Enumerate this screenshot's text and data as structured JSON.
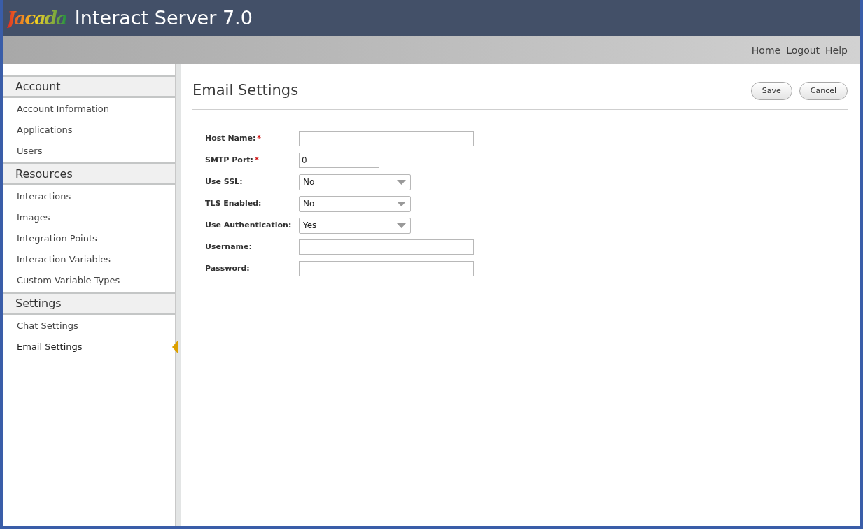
{
  "header": {
    "logo": "Jacada",
    "title": "Interact Server 7.0"
  },
  "top_links": [
    "Home",
    "Logout",
    "Help"
  ],
  "sidebar": [
    {
      "heading": "Account",
      "items": [
        {
          "label": "Account Information",
          "selected": false
        },
        {
          "label": "Applications",
          "selected": false
        },
        {
          "label": "Users",
          "selected": false
        }
      ]
    },
    {
      "heading": "Resources",
      "items": [
        {
          "label": "Interactions",
          "selected": false
        },
        {
          "label": "Images",
          "selected": false
        },
        {
          "label": "Integration Points",
          "selected": false
        },
        {
          "label": "Interaction Variables",
          "selected": false
        },
        {
          "label": "Custom Variable Types",
          "selected": false
        }
      ]
    },
    {
      "heading": "Settings",
      "items": [
        {
          "label": "Chat Settings",
          "selected": false
        },
        {
          "label": "Email Settings",
          "selected": true
        }
      ]
    }
  ],
  "page": {
    "title": "Email Settings",
    "buttons": [
      "Save",
      "Cancel"
    ]
  },
  "fields": [
    {
      "label": "Host Name:",
      "required_mark": "*",
      "kind": "text"
    },
    {
      "label": "SMTP Port:",
      "required_mark": "*",
      "kind": "short_text",
      "value": "0"
    },
    {
      "label": "Use SSL:",
      "kind": "select",
      "value": "No"
    },
    {
      "label": "TLS Enabled:",
      "kind": "select",
      "value": "No"
    },
    {
      "label": "Use Authentication:",
      "kind": "select",
      "value": "Yes"
    },
    {
      "label": "Username:",
      "kind": "text"
    },
    {
      "label": "Password:",
      "kind": "text"
    }
  ]
}
